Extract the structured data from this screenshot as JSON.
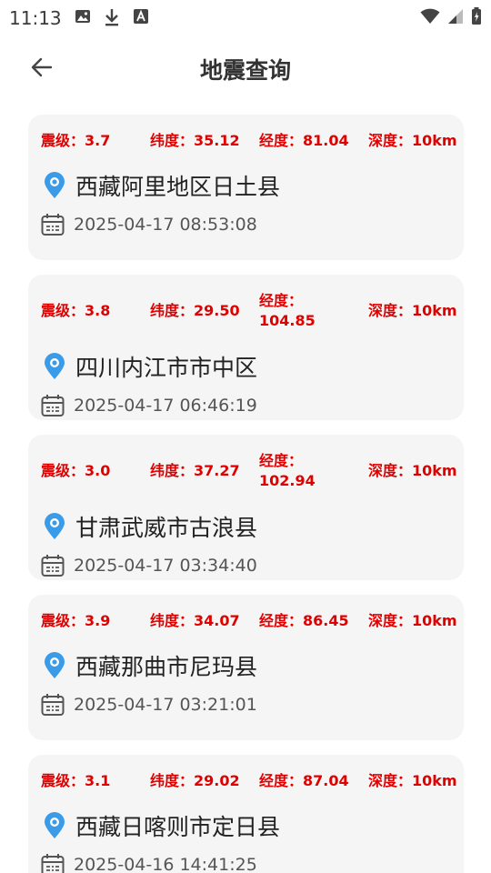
{
  "status_bar": {
    "time": "11:13",
    "left_icons": [
      "image-icon",
      "download-icon",
      "font-icon"
    ],
    "right_icons": [
      "wifi-icon",
      "signal-icon",
      "battery-icon"
    ]
  },
  "header": {
    "title": "地震查询",
    "back_icon": "arrow-left-icon"
  },
  "colors": {
    "metric_red": "#e00000",
    "pin_blue": "#3a9be8",
    "card_bg": "#f5f5f5"
  },
  "quakes": [
    {
      "magnitude": "震级：3.7",
      "latitude": "纬度：35.12",
      "longitude": "经度：81.04",
      "depth": "深度：10km",
      "location": "西藏阿里地区日土县",
      "time": "2025-04-17 08:53:08"
    },
    {
      "magnitude": "震级：3.8",
      "latitude": "纬度：29.50",
      "longitude": "经度：104.85",
      "depth": "深度：10km",
      "location": "四川内江市市中区",
      "time": "2025-04-17 06:46:19"
    },
    {
      "magnitude": "震级：3.0",
      "latitude": "纬度：37.27",
      "longitude": "经度：102.94",
      "depth": "深度：10km",
      "location": "甘肃武威市古浪县",
      "time": "2025-04-17 03:34:40"
    },
    {
      "magnitude": "震级：3.9",
      "latitude": "纬度：34.07",
      "longitude": "经度：86.45",
      "depth": "深度：10km",
      "location": "西藏那曲市尼玛县",
      "time": "2025-04-17 03:21:01"
    },
    {
      "magnitude": "震级：3.1",
      "latitude": "纬度：29.02",
      "longitude": "经度：87.04",
      "depth": "深度：10km",
      "location": "西藏日喀则市定日县",
      "time": "2025-04-16 14:41:25"
    }
  ]
}
